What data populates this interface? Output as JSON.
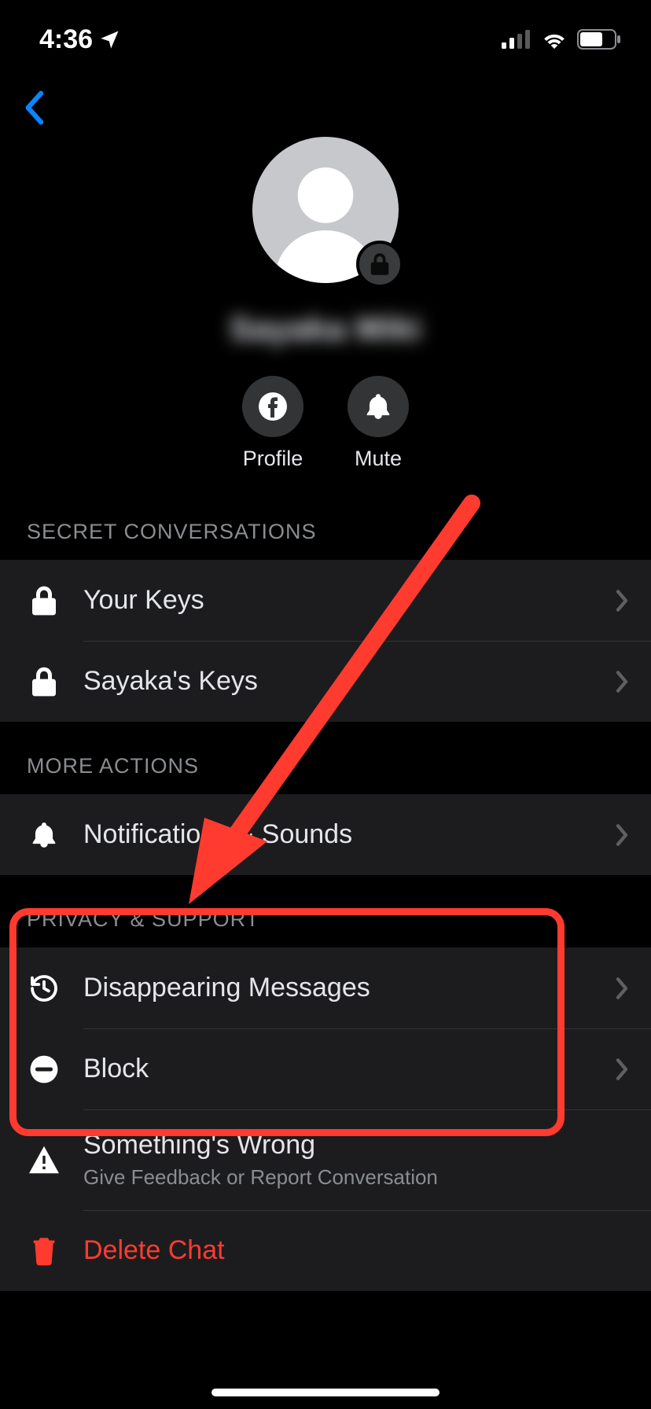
{
  "status": {
    "time": "4:36"
  },
  "actions": {
    "profile": "Profile",
    "mute": "Mute"
  },
  "contact": {
    "name": "Sayaka Miki"
  },
  "sections": {
    "secret": {
      "header": "SECRET CONVERSATIONS",
      "your_keys": "Your Keys",
      "their_keys": "Sayaka's Keys"
    },
    "more": {
      "header": "MORE ACTIONS",
      "notifications": "Notifications & Sounds"
    },
    "privacy": {
      "header": "PRIVACY & SUPPORT",
      "disappearing": "Disappearing Messages",
      "block": "Block",
      "wrong": "Something's Wrong",
      "wrong_sub": "Give Feedback or Report Conversation",
      "delete": "Delete Chat"
    }
  },
  "colors": {
    "danger": "#ff3b30",
    "annotation": "#ff3b2f"
  }
}
